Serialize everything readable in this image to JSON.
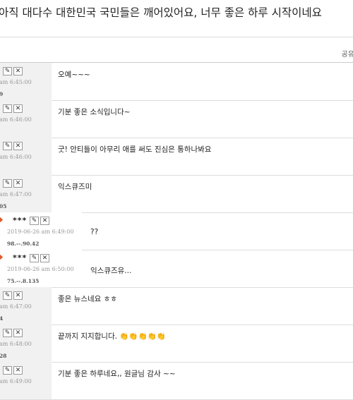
{
  "page": {
    "title": "아직 대다수 대한민국 국민들은 깨어있어요, 너무 좋은 하루 시작이네요",
    "share_label": "공유"
  },
  "comments": [
    {
      "nick": "",
      "time": "am 6:45:00",
      "ip": "9",
      "text": "오예~~~"
    },
    {
      "nick": "",
      "time": "am 6:46:00",
      "ip": "",
      "text": "기분 좋은 소식입니다~"
    },
    {
      "nick": "",
      "time": "am 6:46:00",
      "ip": "",
      "text": "굿! 안티들이 아무리 애를 써도 진심은 통하나봐요"
    },
    {
      "nick": "",
      "time": "am 6:47:00",
      "ip": "05",
      "text": "익스큐즈미"
    },
    {
      "nick": "***",
      "time": "2019-06-26 am 6:49:00",
      "ip": "98.--.90.42",
      "text": "??"
    },
    {
      "nick": "***",
      "time": "2019-06-26 am 6:50:00",
      "ip": "75.--.8.135",
      "text": "익스큐즈유..."
    },
    {
      "nick": "",
      "time": "am 6:47:00",
      "ip": "4",
      "text": "좋은 뉴스네요 ㅎㅎ"
    },
    {
      "nick": "",
      "time": "am 6:48:00",
      "ip": "28",
      "text": "끝까지 지지합니다. 👏👏👏👏👏"
    },
    {
      "nick": "",
      "time": "am 6:49:00",
      "ip": "",
      "text": "기분 좋은 하루네요,, 원글님 감사 ~~"
    }
  ],
  "icons": {
    "edit": "pencil-icon",
    "delete": "close-icon",
    "reply_marker": "diamond-icon"
  },
  "colors": {
    "meta_bg": "#f1f1f1",
    "marker": "#e05a2b"
  }
}
